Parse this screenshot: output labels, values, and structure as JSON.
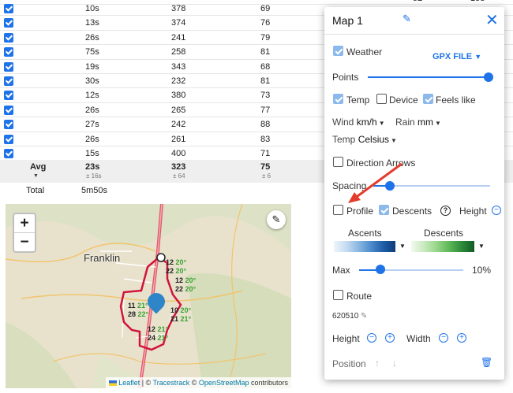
{
  "table": {
    "top_row": [
      "52",
      "155",
      "158"
    ],
    "rows": [
      {
        "time": "10s",
        "v1": "378",
        "v2": "69"
      },
      {
        "time": "13s",
        "v1": "374",
        "v2": "76"
      },
      {
        "time": "26s",
        "v1": "241",
        "v2": "79"
      },
      {
        "time": "75s",
        "v1": "258",
        "v2": "81"
      },
      {
        "time": "19s",
        "v1": "343",
        "v2": "68"
      },
      {
        "time": "30s",
        "v1": "232",
        "v2": "81"
      },
      {
        "time": "12s",
        "v1": "380",
        "v2": "73"
      },
      {
        "time": "26s",
        "v1": "265",
        "v2": "77"
      },
      {
        "time": "27s",
        "v1": "242",
        "v2": "88"
      },
      {
        "time": "26s",
        "v1": "261",
        "v2": "83"
      },
      {
        "time": "15s",
        "v1": "400",
        "v2": "71"
      }
    ],
    "avg": {
      "label": "Avg",
      "time": "23s",
      "time_sd": "± 16s",
      "v1": "323",
      "v1_sd": "± 64",
      "v2": "75",
      "v2_sd": "± 6"
    },
    "total": {
      "label": "Total",
      "time": "5m50s"
    }
  },
  "map": {
    "zoom_in": "+",
    "zoom_out": "−",
    "town": "Franklin",
    "weather_labels": [
      {
        "a": "12",
        "b": "20°"
      },
      {
        "a": "22",
        "b": "20°"
      },
      {
        "a": "12",
        "b": "20°"
      },
      {
        "a": "22",
        "b": "20°"
      },
      {
        "a": "11",
        "b": "21°"
      },
      {
        "a": "28",
        "b": "22°"
      },
      {
        "a": "10",
        "b": "20°"
      },
      {
        "a": "21",
        "b": "21°"
      },
      {
        "a": "12",
        "b": "21°"
      },
      {
        "a": "24",
        "b": "21°"
      }
    ],
    "attribution": {
      "leaflet": "Leaflet",
      "sep1": " | © ",
      "tracestrack": "Tracestrack",
      "sep2": " © ",
      "osm": "OpenStreetMap",
      "suffix": " contributors"
    }
  },
  "panel": {
    "title": "Map 1",
    "weather_label": "Weather",
    "gpx_label": "GPX FILE",
    "points_label": "Points",
    "temp_label": "Temp",
    "device_label": "Device",
    "feels_label": "Feels like",
    "wind_label": "Wind",
    "wind_value": "km/h",
    "rain_label": "Rain",
    "rain_value": "mm",
    "temp_unit_label": "Temp",
    "temp_unit_value": "Celsius",
    "direction_label": "Direction Arrows",
    "spacing_label": "Spacing",
    "profile_label": "Profile",
    "descents_label": "Descents",
    "height_label": "Height",
    "ascents_title": "Ascents",
    "descents_title": "Descents",
    "max_label": "Max",
    "max_value": "10%",
    "route_label": "Route",
    "route_id": "620510",
    "height2_label": "Height",
    "width_label": "Width",
    "position_label": "Position",
    "colors": {
      "accent": "#1e73e8",
      "checked": "#8bb9ec",
      "arrow": "#e53b2c"
    }
  }
}
